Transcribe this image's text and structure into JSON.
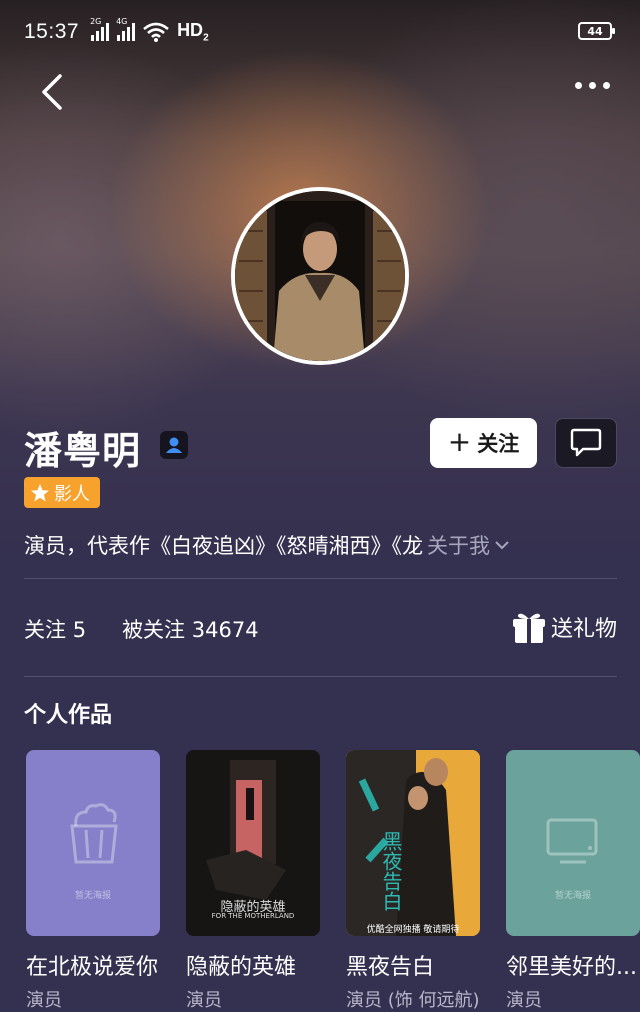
{
  "status": {
    "time": "15:37",
    "sig1": "2G",
    "sig2": "4G",
    "hd": "HD",
    "hd_sub": "2",
    "battery": "44"
  },
  "profile": {
    "name": "潘粤明",
    "tag": "影人",
    "bio": "演员，代表作《白夜追凶》《怒晴湘西》《龙",
    "about": "关于我"
  },
  "actions": {
    "follow": "关注"
  },
  "stats": {
    "following_label": "关注",
    "following_count": "5",
    "followers_label": "被关注",
    "followers_count": "34674",
    "gift": "送礼物"
  },
  "works": {
    "title": "个人作品",
    "items": [
      {
        "title": "在北极说爱你",
        "role": "演员",
        "placeholder": "暂无海报"
      },
      {
        "title": "隐蔽的英雄",
        "role": "演员",
        "poster_cn": "隐蔽的英雄",
        "poster_en": "FOR THE MOTHERLAND"
      },
      {
        "title": "黑夜告白",
        "role": "演员 (饰 何远航)",
        "poster_cn": "黑夜告白",
        "poster_note": "优酷全网独播  敬请期待"
      },
      {
        "title": "邻里美好的...",
        "role": "演员",
        "placeholder": "暂无海报"
      }
    ]
  },
  "colors": {
    "background": "#34304f",
    "tag": "#f6a22c",
    "card1": "#8580c9",
    "card4": "#6ba39c"
  }
}
